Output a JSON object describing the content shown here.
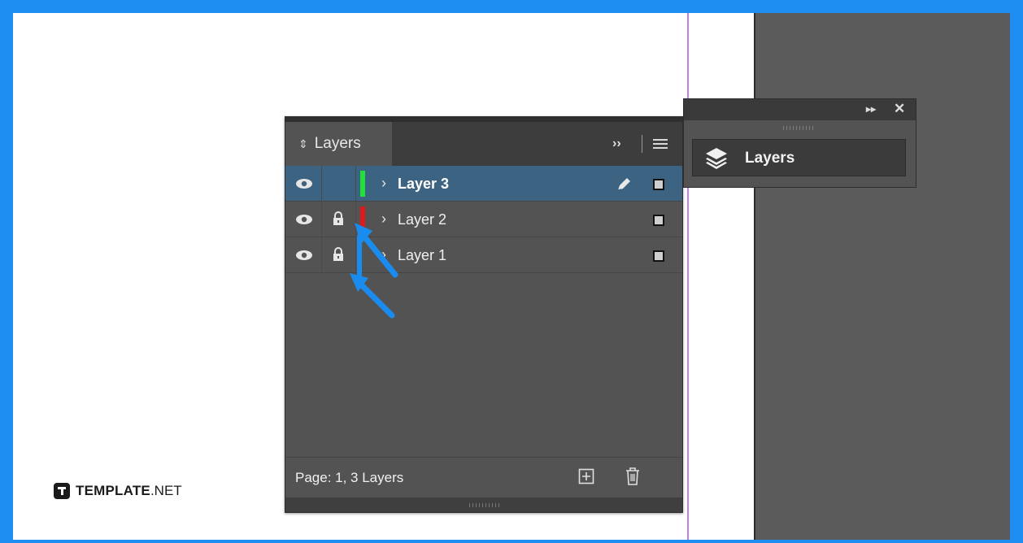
{
  "panel": {
    "tab_label": "Layers",
    "layers": [
      {
        "name": "Layer 3",
        "color": "#22e03a",
        "selected": true,
        "locked": false,
        "editable": true
      },
      {
        "name": "Layer 2",
        "color": "#e0191c",
        "selected": false,
        "locked": true,
        "editable": false
      },
      {
        "name": "Layer 1",
        "color": "#e0191c",
        "selected": false,
        "locked": true,
        "editable": false
      }
    ],
    "footer_text": "Page: 1, 3 Layers"
  },
  "mini_panel": {
    "label": "Layers"
  },
  "watermark": {
    "bold": "TEMPLATE",
    "light": ".NET"
  },
  "colors": {
    "frame": "#1e8ef2",
    "selection": "#3c6382",
    "arrow": "#1a8cf0",
    "guide": "#c37ee8"
  }
}
